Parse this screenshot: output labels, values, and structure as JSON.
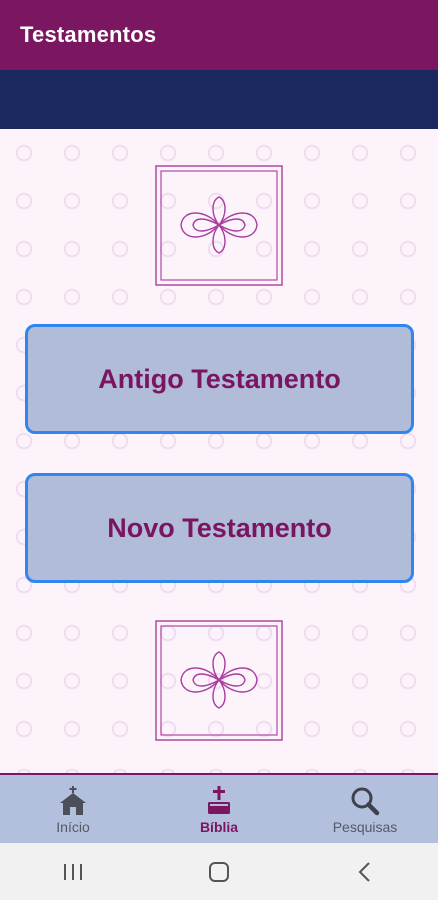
{
  "appbar": {
    "title": "Testamentos"
  },
  "colors": {
    "appbar": "#7a1760",
    "subbar": "#1c2860",
    "background": "#fcf3fb",
    "button_fill": "#b0bcd8",
    "button_border": "#2f86f0",
    "button_text": "#7a1560",
    "bottom_nav": "#b2bfdd"
  },
  "buttons": {
    "old_testament": "Antigo Testamento",
    "new_testament": "Novo Testamento"
  },
  "ornaments": [
    "celtic-knot-frame-icon",
    "celtic-knot-frame-icon"
  ],
  "bottom_nav": {
    "items": [
      {
        "label": "Início",
        "icon": "church-icon",
        "active": false
      },
      {
        "label": "Bíblia",
        "icon": "bible-cross-icon",
        "active": true
      },
      {
        "label": "Pesquisas",
        "icon": "search-icon",
        "active": false
      }
    ]
  },
  "system_nav": [
    "recent-apps-icon",
    "home-icon",
    "back-icon"
  ]
}
